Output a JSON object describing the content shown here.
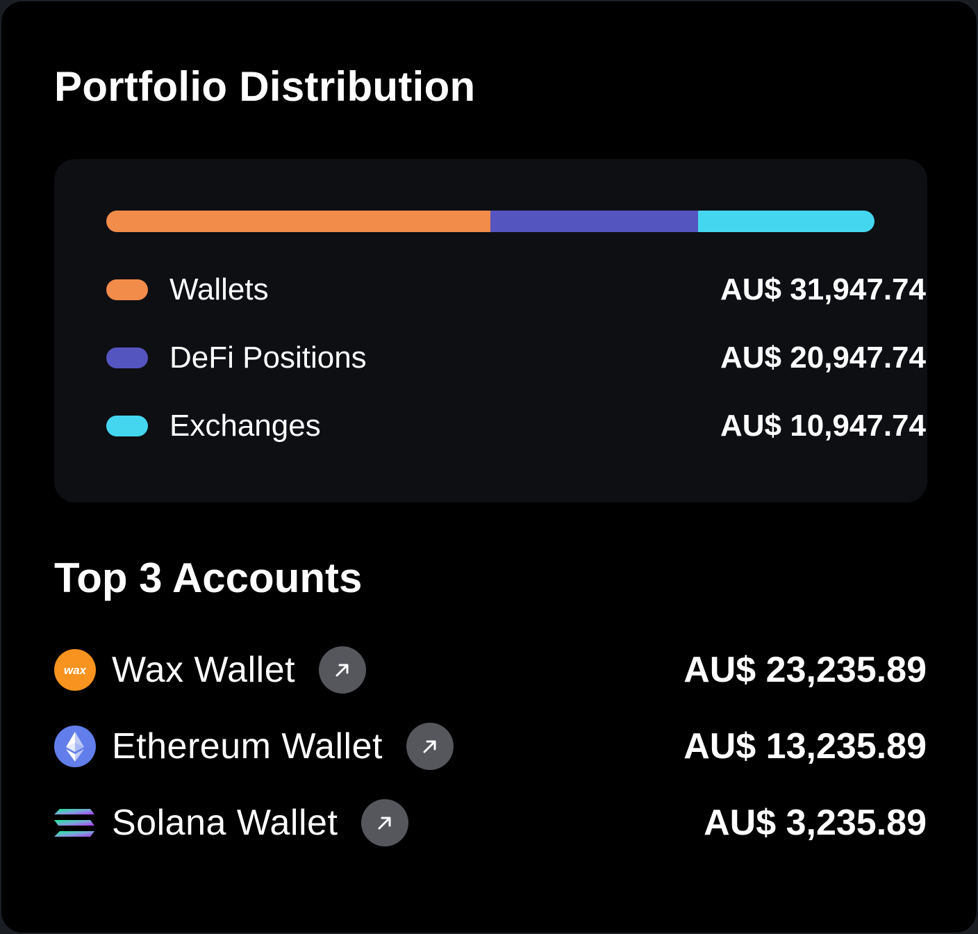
{
  "portfolio": {
    "title": "Portfolio Distribution",
    "categories": [
      {
        "name": "Wallets",
        "value": "AU$ 31,947.74",
        "color": "#f28c4a",
        "fraction": 0.4997
      },
      {
        "name": "DeFi Positions",
        "value": "AU$ 20,947.74",
        "color": "#5555c0",
        "fraction": 0.2703
      },
      {
        "name": "Exchanges",
        "value": "AU$ 10,947.74",
        "color": "#45d6ef",
        "fraction": 0.23
      }
    ]
  },
  "top_accounts": {
    "title": "Top 3 Accounts",
    "items": [
      {
        "name": "Wax Wallet",
        "value": "AU$ 23,235.89",
        "icon": "wax-icon",
        "logo_text": "wax"
      },
      {
        "name": "Ethereum Wallet",
        "value": "AU$ 13,235.89",
        "icon": "ethereum-icon"
      },
      {
        "name": "Solana Wallet",
        "value": "AU$ 3,235.89",
        "icon": "solana-icon"
      }
    ],
    "link_icon": "arrow-up-right-icon"
  }
}
